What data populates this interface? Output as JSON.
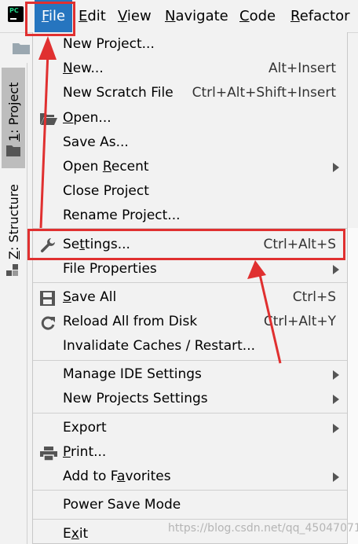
{
  "menubar": {
    "app_logo_text": "PC",
    "items": [
      {
        "label": "File",
        "mnemonic": "F",
        "rest": "ile"
      },
      {
        "label": "Edit",
        "mnemonic": "E",
        "rest": "dit"
      },
      {
        "label": "View",
        "mnemonic": "V",
        "rest": "iew"
      },
      {
        "label": "Navigate",
        "mnemonic": "N",
        "rest": "avigate"
      },
      {
        "label": "Code",
        "mnemonic": "C",
        "rest": "ode"
      },
      {
        "label": "Refactor",
        "mnemonic": "R",
        "rest": "efactor"
      }
    ]
  },
  "side_tabs": {
    "project": {
      "prefix": "1",
      "label": ": Project"
    },
    "structure": {
      "prefix": "Z",
      "label": ": Structure"
    }
  },
  "file_menu": {
    "new_project": {
      "label": "New Project..."
    },
    "new": {
      "pre": "",
      "mn": "N",
      "post": "ew...",
      "shortcut": "Alt+Insert"
    },
    "new_scratch": {
      "label": "New Scratch File",
      "shortcut": "Ctrl+Alt+Shift+Insert"
    },
    "open": {
      "pre": "",
      "mn": "O",
      "post": "pen..."
    },
    "save_as": {
      "label": "Save As..."
    },
    "open_recent": {
      "pre": "Open ",
      "mn": "R",
      "post": "ecent"
    },
    "close_project": {
      "pre": "Close Pro",
      "mn": "j",
      "post": "ect"
    },
    "rename_project": {
      "label": "Rename Project..."
    },
    "settings": {
      "pre": "Se",
      "mn": "t",
      "post": "tings...",
      "shortcut": "Ctrl+Alt+S"
    },
    "file_properties": {
      "label": "File Properties"
    },
    "save_all": {
      "pre": "",
      "mn": "S",
      "post": "ave All",
      "shortcut": "Ctrl+S"
    },
    "reload_all": {
      "label": "Reload All from Disk",
      "shortcut": "Ctrl+Alt+Y"
    },
    "invalidate": {
      "label": "Invalidate Caches / Restart..."
    },
    "manage_ide": {
      "label": "Manage IDE Settings"
    },
    "new_projects_settings": {
      "label": "New Projects Settings"
    },
    "export": {
      "label": "Export"
    },
    "print": {
      "pre": "",
      "mn": "P",
      "post": "rint..."
    },
    "add_favorites": {
      "pre": "Add to F",
      "mn": "a",
      "post": "vorites"
    },
    "power_save": {
      "label": "Power Save Mode"
    },
    "exit": {
      "pre": "E",
      "mn": "x",
      "post": "it"
    }
  },
  "watermark": "https://blog.csdn.net/qq_45047071",
  "colors": {
    "highlight": "#e03030",
    "menu_selected": "#2675bf"
  }
}
